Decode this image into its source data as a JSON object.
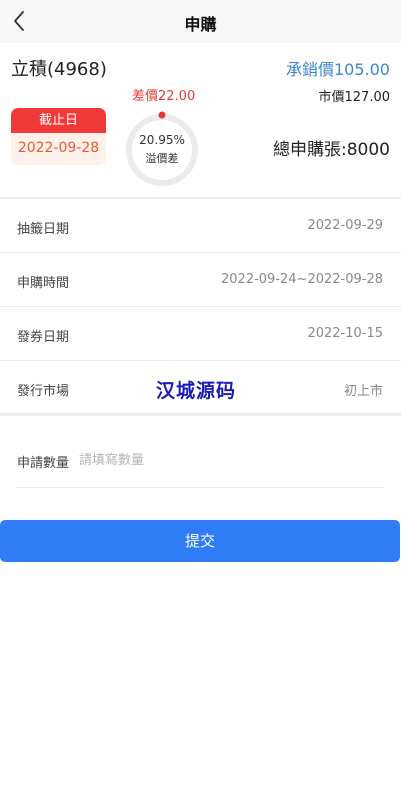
{
  "header": {
    "title": "申購",
    "back_icon": "chevron-left-icon"
  },
  "stock": {
    "name": "立積(4968)",
    "underwrite_price": "承銷價105.00",
    "price_diff": "差價22.00",
    "market_price": "市價127.00",
    "deadline_label": "截止日",
    "deadline_date": "2022-09-28",
    "premium_percent": "20.95%",
    "premium_label": "溢價差",
    "total_applied": "總申購張:8000"
  },
  "info_rows": [
    {
      "label": "抽籤日期",
      "value": "2022-09-29"
    },
    {
      "label": "申購時間",
      "value": "2022-09-24~2022-09-28"
    },
    {
      "label": "發券日期",
      "value": "2022-10-15"
    },
    {
      "label": "發行市場",
      "value": "初上市"
    }
  ],
  "watermark": "汉城源码",
  "quantity": {
    "label": "申請數量",
    "placeholder": "請填寫數量",
    "value": ""
  },
  "submit_label": "提交",
  "colors": {
    "accent_blue": "#3a86d2",
    "button_blue": "#2f7cf6",
    "red": "#e53935",
    "deadline_bg": "#fdf1ea"
  }
}
